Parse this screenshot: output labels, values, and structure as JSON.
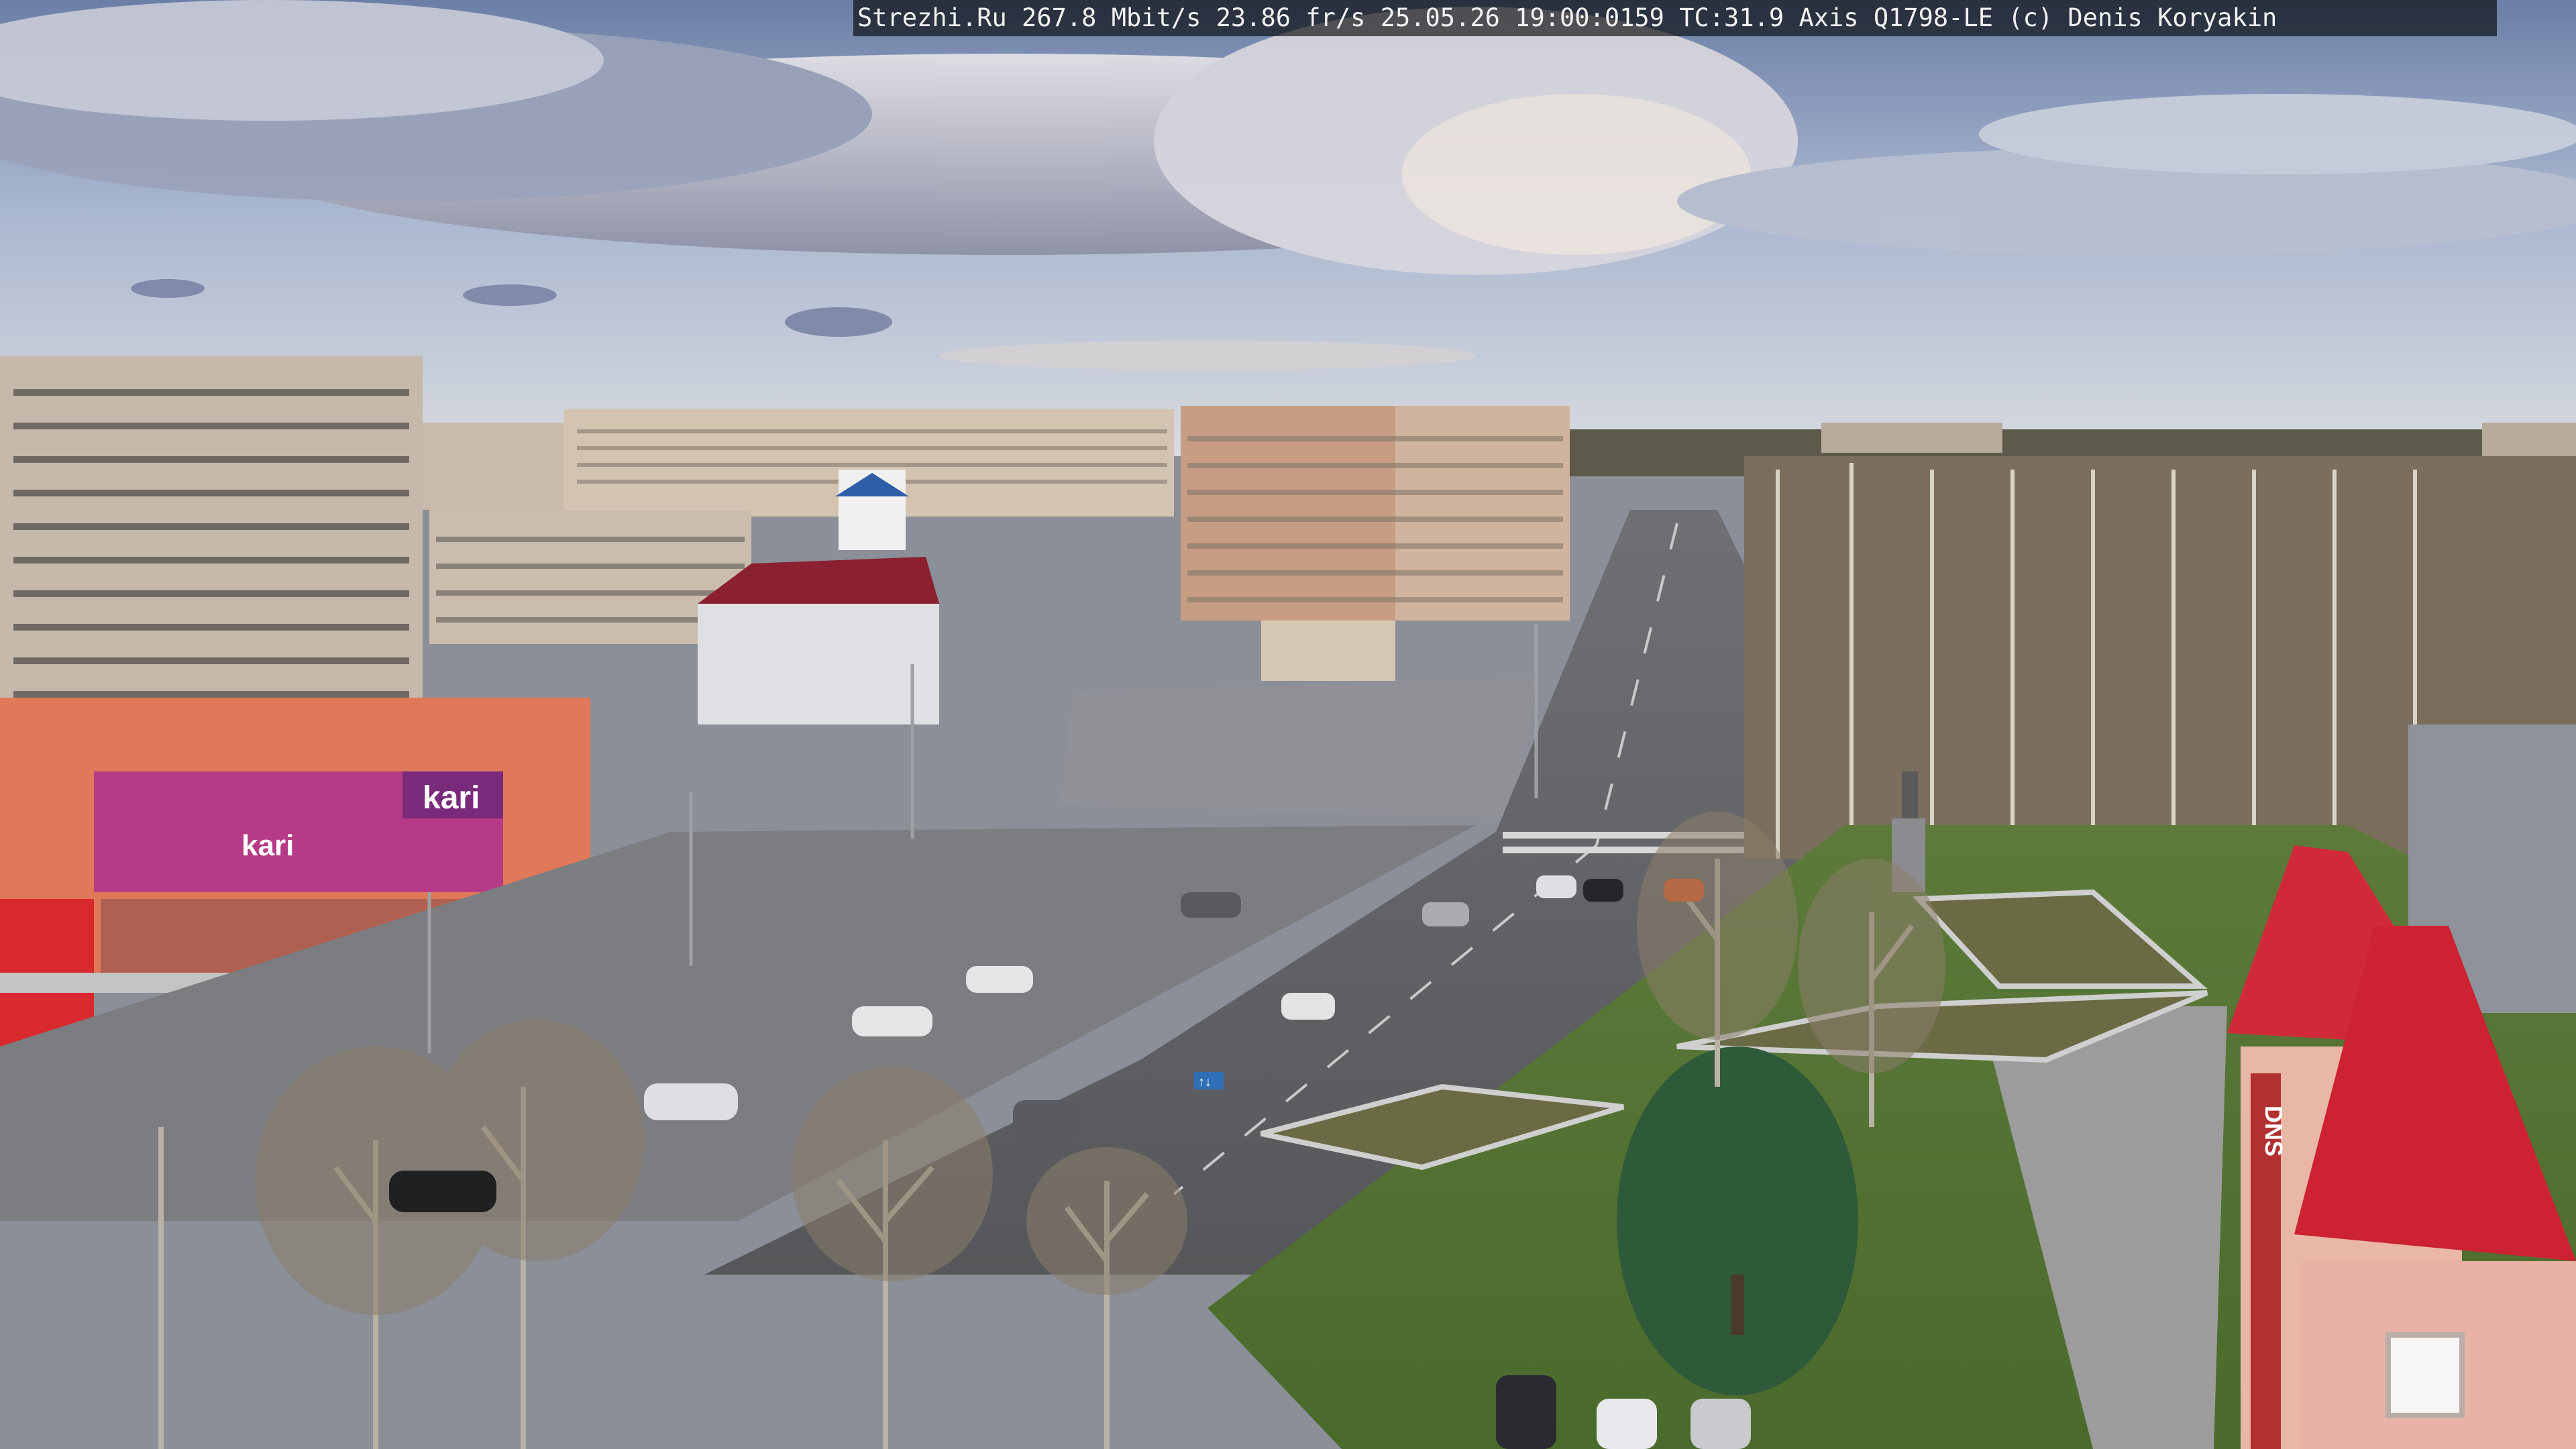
{
  "overlay": {
    "site": "Strezhi.Ru",
    "bitrate": "267.8 Mbit/s",
    "framerate": "23.86 fr/s",
    "timestamp": "25.05.26 19:00:0159",
    "tc": "TC:31.9",
    "camera": "Axis Q1798-LE",
    "credit": "(c) Denis Koryakin"
  },
  "signs": {
    "kari_main": "kari",
    "kari_front": "kari",
    "dns_vertical": "DNS",
    "road_sign_lanes": "↑↓"
  }
}
